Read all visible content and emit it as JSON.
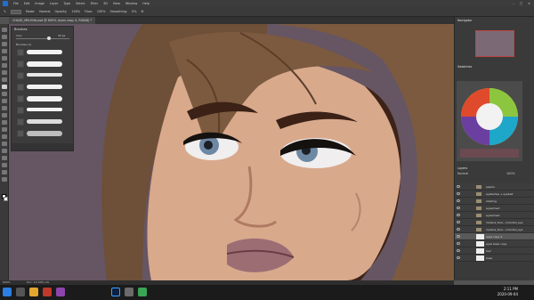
{
  "menubar": {
    "items": [
      "File",
      "Edit",
      "Image",
      "Layer",
      "Type",
      "Select",
      "Filter",
      "3D",
      "View",
      "Window",
      "Help"
    ]
  },
  "options": {
    "mode_label": "Mode:",
    "mode_value": "Normal",
    "opacity_label": "Opacity:",
    "opacity_value": "100%",
    "flow_label": "Flow:",
    "flow_value": "100%",
    "smoothing_label": "Smoothing:",
    "smoothing_value": "0%"
  },
  "document": {
    "tab_title": "CHASE_MELENA.psd @ 600% (eyes copy 4, RGB/8) *"
  },
  "brushes": {
    "title": "Brushes",
    "size_label": "Size:",
    "size_value": "33 px",
    "folder_label": "Brushes (1)"
  },
  "right": {
    "navigator_title": "Navigator",
    "swatches_title": "Swatches",
    "layers_title": "Layers",
    "blend_mode": "Normal",
    "opacity_value": "100%"
  },
  "layers": [
    {
      "name": "sparks",
      "type": "folder"
    },
    {
      "name": "eyelashes + eyeball",
      "type": "folder"
    },
    {
      "name": "shading",
      "type": "folder"
    },
    {
      "name": "eyes/lined",
      "type": "folder"
    },
    {
      "name": "eyes/lined",
      "type": "folder"
    },
    {
      "name": "melena_face...orrected_eye",
      "type": "folder"
    },
    {
      "name": "melena_face...orrected_eye",
      "type": "folder"
    },
    {
      "name": "eyes copy 4",
      "type": "layer",
      "active": true
    },
    {
      "name": "eyes base copy",
      "type": "layer"
    },
    {
      "name": "hair",
      "type": "layer"
    },
    {
      "name": "base",
      "type": "layer"
    }
  ],
  "status": {
    "zoom": "600%",
    "doc": "Doc: 10.1M/1.2G"
  },
  "taskbar": {
    "time": "2:11 PM",
    "date": "2020-09-04"
  },
  "colors": {
    "accent": "#1f6fd1",
    "canvas_bg": "#665563",
    "hair": "#7a5a40",
    "skin": "#d9a98c"
  }
}
